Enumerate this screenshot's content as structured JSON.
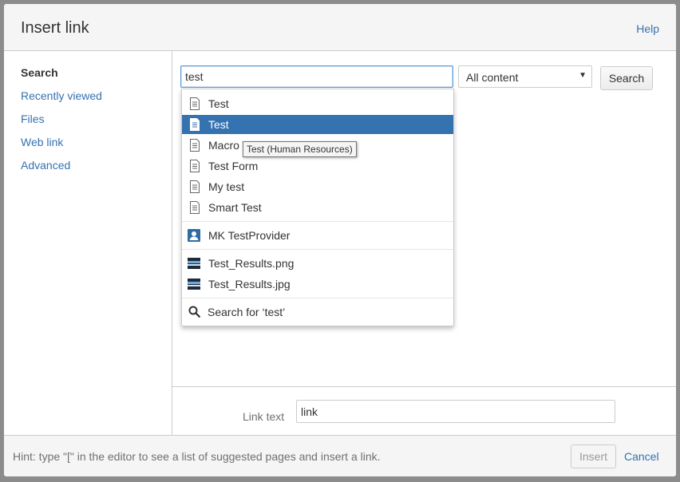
{
  "dialog": {
    "title": "Insert link",
    "help_label": "Help"
  },
  "sidebar": {
    "items": [
      {
        "label": "Search"
      },
      {
        "label": "Recently viewed"
      },
      {
        "label": "Files"
      },
      {
        "label": "Web link"
      },
      {
        "label": "Advanced"
      }
    ]
  },
  "search": {
    "query": "test",
    "scope_selected": "All content",
    "button_label": "Search"
  },
  "dropdown": {
    "pages": [
      {
        "label": "Test",
        "icon": "page-icon"
      },
      {
        "label": "Test",
        "icon": "page-icon",
        "selected": true
      },
      {
        "label": "Macro Test",
        "icon": "page-icon"
      },
      {
        "label": "Test Form",
        "icon": "page-icon"
      },
      {
        "label": "My test",
        "icon": "page-icon"
      },
      {
        "label": "Smart Test",
        "icon": "page-icon"
      }
    ],
    "users": [
      {
        "label": "MK TestProvider",
        "icon": "user-icon"
      }
    ],
    "files": [
      {
        "label": "Test_Results.png",
        "icon": "image-icon"
      },
      {
        "label": "Test_Results.jpg",
        "icon": "image-icon"
      }
    ],
    "search_for": {
      "label": "Search for ‘test’",
      "icon": "search-icon"
    },
    "tooltip": "Test (Human Resources)"
  },
  "link_text": {
    "label": "Link text",
    "value": "link"
  },
  "footer": {
    "hint": "Hint: type \"[\" in the editor to see a list of suggested pages and insert a link.",
    "insert_label": "Insert",
    "cancel_label": "Cancel"
  },
  "colors": {
    "accent": "#3572b0",
    "selected_bg": "#3572b0",
    "header_bg": "#f5f5f5",
    "backdrop": "#8c8c8c"
  }
}
